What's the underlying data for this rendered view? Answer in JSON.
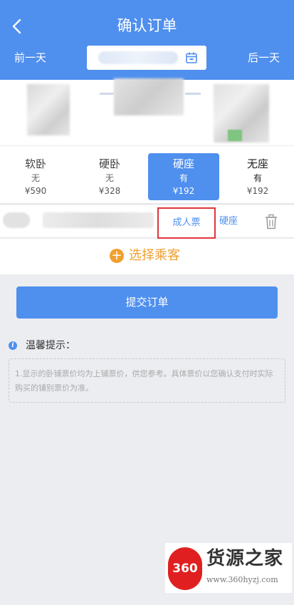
{
  "header": {
    "title": "确认订单",
    "prev_day": "前一天",
    "next_day": "后一天"
  },
  "seats": [
    {
      "name": "软卧",
      "availability": "无",
      "price": "¥590"
    },
    {
      "name": "硬卧",
      "availability": "无",
      "price": "¥328"
    },
    {
      "name": "硬座",
      "availability": "有",
      "price": "¥192",
      "selected": true
    },
    {
      "name": "无座",
      "availability": "有",
      "price": "¥192"
    }
  ],
  "passenger": {
    "ticket_type": "成人票",
    "seat_type": "硬座"
  },
  "select_passenger": "选择乘客",
  "submit_label": "提交订单",
  "tips": {
    "title": "温馨提示：",
    "text": "1.显示的卧铺票价均为上铺票价，供您参考。具体票价以您确认支付时实际购买的铺别票价为准。"
  },
  "watermark": {
    "logo": "360",
    "name": "货源之家",
    "url": "www.360hyzj.com"
  },
  "colors": {
    "primary": "#4f8fee",
    "accent": "#f0a030",
    "highlight_border": "#e0343a"
  }
}
